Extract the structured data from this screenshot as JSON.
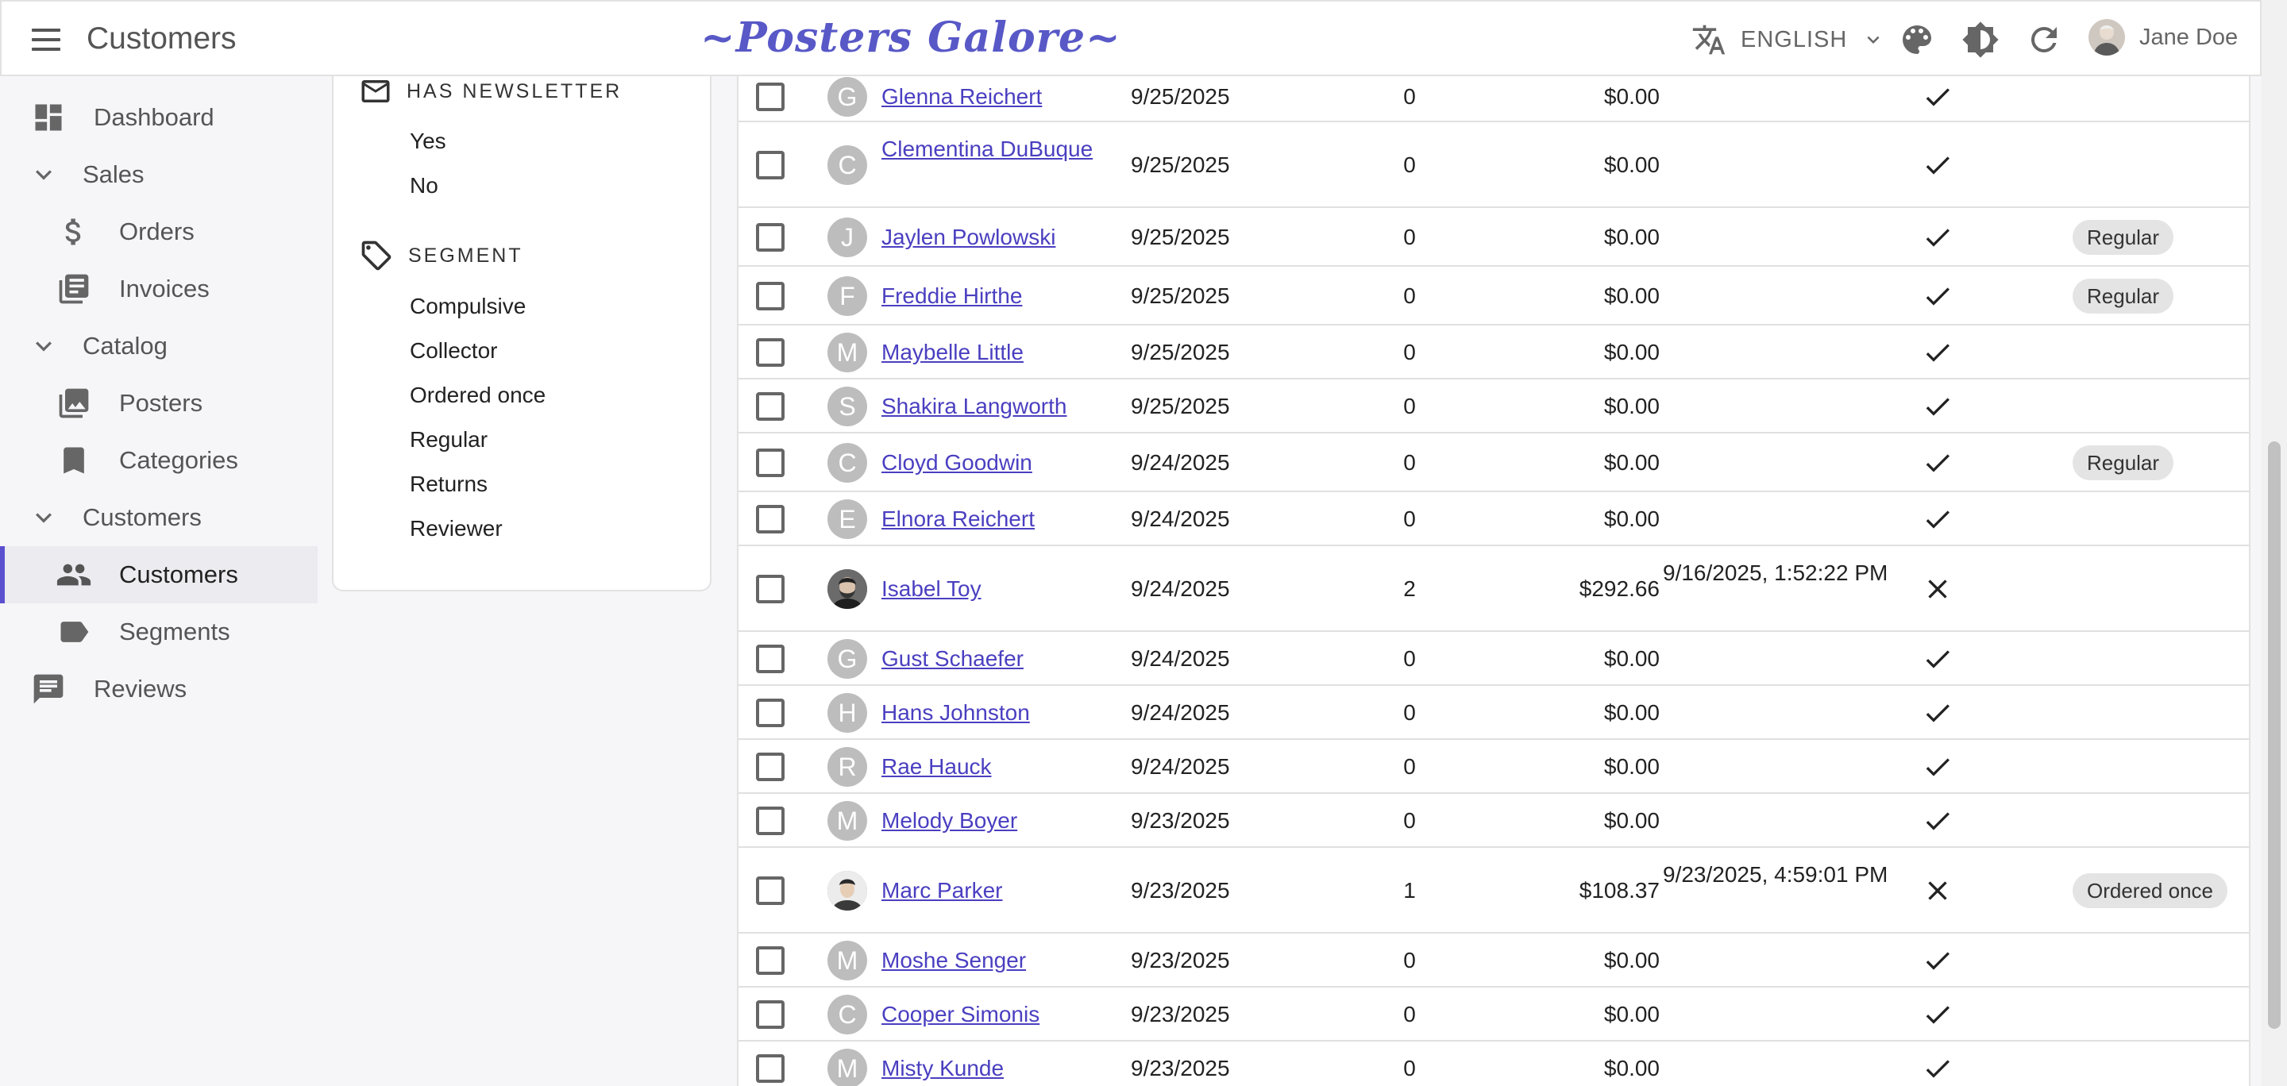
{
  "header": {
    "app_title": "Customers",
    "brand": "~Posters Galore~",
    "language": "ENGLISH",
    "user_name": "Jane Doe"
  },
  "sidebar": {
    "dashboard": "Dashboard",
    "sales": "Sales",
    "orders": "Orders",
    "invoices": "Invoices",
    "catalog": "Catalog",
    "posters": "Posters",
    "categories": "Categories",
    "customers_group": "Customers",
    "customers": "Customers",
    "segments": "Segments",
    "reviews": "Reviews"
  },
  "filters": {
    "newsletter": {
      "title": "HAS NEWSLETTER",
      "options": [
        "Yes",
        "No"
      ]
    },
    "segment": {
      "title": "SEGMENT",
      "options": [
        "Compulsive",
        "Collector",
        "Ordered once",
        "Regular",
        "Returns",
        "Reviewer"
      ]
    }
  },
  "rows": [
    {
      "initial": "G",
      "name": "Glenna Reichert",
      "date": "9/25/2025",
      "orders": "0",
      "spent": "$0.00",
      "last": "",
      "newsletter": true,
      "segment": ""
    },
    {
      "initial": "C",
      "name": "Clementina DuBuque",
      "date": "9/25/2025",
      "orders": "0",
      "spent": "$0.00",
      "last": "",
      "newsletter": true,
      "segment": ""
    },
    {
      "initial": "J",
      "name": "Jaylen Powlowski",
      "date": "9/25/2025",
      "orders": "0",
      "spent": "$0.00",
      "last": "",
      "newsletter": true,
      "segment": "Regular"
    },
    {
      "initial": "F",
      "name": "Freddie Hirthe",
      "date": "9/25/2025",
      "orders": "0",
      "spent": "$0.00",
      "last": "",
      "newsletter": true,
      "segment": "Regular"
    },
    {
      "initial": "M",
      "name": "Maybelle Little",
      "date": "9/25/2025",
      "orders": "0",
      "spent": "$0.00",
      "last": "",
      "newsletter": true,
      "segment": ""
    },
    {
      "initial": "S",
      "name": "Shakira Langworth",
      "date": "9/25/2025",
      "orders": "0",
      "spent": "$0.00",
      "last": "",
      "newsletter": true,
      "segment": ""
    },
    {
      "initial": "C",
      "name": "Cloyd Goodwin",
      "date": "9/24/2025",
      "orders": "0",
      "spent": "$0.00",
      "last": "",
      "newsletter": true,
      "segment": "Regular"
    },
    {
      "initial": "E",
      "name": "Elnora Reichert",
      "date": "9/24/2025",
      "orders": "0",
      "spent": "$0.00",
      "last": "",
      "newsletter": true,
      "segment": ""
    },
    {
      "initial": "",
      "photo": true,
      "name": "Isabel Toy",
      "date": "9/24/2025",
      "orders": "2",
      "spent": "$292.66",
      "last": "9/16/2025, 1:52:22 PM",
      "newsletter": false,
      "segment": ""
    },
    {
      "initial": "G",
      "name": "Gust Schaefer",
      "date": "9/24/2025",
      "orders": "0",
      "spent": "$0.00",
      "last": "",
      "newsletter": true,
      "segment": ""
    },
    {
      "initial": "H",
      "name": "Hans Johnston",
      "date": "9/24/2025",
      "orders": "0",
      "spent": "$0.00",
      "last": "",
      "newsletter": true,
      "segment": ""
    },
    {
      "initial": "R",
      "name": "Rae Hauck",
      "date": "9/24/2025",
      "orders": "0",
      "spent": "$0.00",
      "last": "",
      "newsletter": true,
      "segment": ""
    },
    {
      "initial": "M",
      "name": "Melody Boyer",
      "date": "9/23/2025",
      "orders": "0",
      "spent": "$0.00",
      "last": "",
      "newsletter": true,
      "segment": ""
    },
    {
      "initial": "",
      "photo": true,
      "name": "Marc Parker",
      "date": "9/23/2025",
      "orders": "1",
      "spent": "$108.37",
      "last": "9/23/2025, 4:59:01 PM",
      "newsletter": false,
      "segment": "Ordered once"
    },
    {
      "initial": "M",
      "name": "Moshe Senger",
      "date": "9/23/2025",
      "orders": "0",
      "spent": "$0.00",
      "last": "",
      "newsletter": true,
      "segment": ""
    },
    {
      "initial": "C",
      "name": "Cooper Simonis",
      "date": "9/23/2025",
      "orders": "0",
      "spent": "$0.00",
      "last": "",
      "newsletter": true,
      "segment": ""
    },
    {
      "initial": "M",
      "name": "Misty Kunde",
      "date": "9/23/2025",
      "orders": "0",
      "spent": "$0.00",
      "last": "",
      "newsletter": true,
      "segment": ""
    }
  ]
}
